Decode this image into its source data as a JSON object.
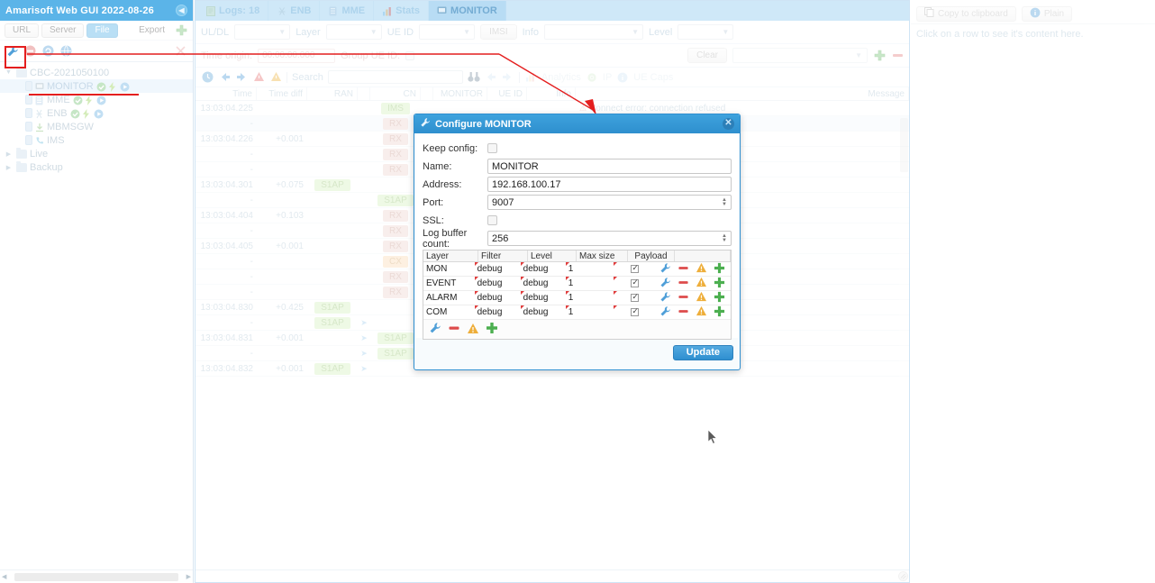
{
  "sidebar": {
    "title": "Amarisoft Web GUI 2022-08-26",
    "collapse_icon": "chevron-left-icon",
    "source_buttons": [
      {
        "label": "URL",
        "active": false
      },
      {
        "label": "Server",
        "active": false
      },
      {
        "label": "File",
        "active": true
      }
    ],
    "export_label": "Export",
    "add_icon": "plus-icon",
    "toolbar_icons": [
      "wrench-icon",
      "minus-icon",
      "refresh-icon",
      "globe-icon",
      "close-icon"
    ],
    "tree": [
      {
        "label": "CBC-2021050100",
        "type": "folder",
        "expanded": true,
        "depth": 0,
        "badges": []
      },
      {
        "label": "MONITOR",
        "type": "node",
        "depth": 1,
        "selected": true,
        "badges": [
          "check-icon",
          "bolt-icon",
          "play-icon"
        ]
      },
      {
        "label": "MME",
        "type": "node",
        "depth": 1,
        "selected": false,
        "badges": [
          "check-icon",
          "bolt-icon",
          "play-icon"
        ]
      },
      {
        "label": "ENB",
        "type": "node",
        "depth": 1,
        "selected": false,
        "badges": [
          "check-icon",
          "bolt-icon",
          "play-icon"
        ]
      },
      {
        "label": "MBMSGW",
        "type": "node",
        "depth": 1,
        "selected": false,
        "badges": []
      },
      {
        "label": "IMS",
        "type": "node",
        "depth": 1,
        "selected": false,
        "badges": []
      },
      {
        "label": "Live",
        "type": "folder",
        "expanded": false,
        "depth": 0,
        "badges": []
      },
      {
        "label": "Backup",
        "type": "folder",
        "expanded": false,
        "depth": 0,
        "badges": []
      }
    ]
  },
  "tabs": [
    {
      "label": "Logs: 18",
      "icon": "document-icon",
      "active": false
    },
    {
      "label": "ENB",
      "icon": "antenna-icon",
      "active": false
    },
    {
      "label": "MME",
      "icon": "server-icon",
      "active": false
    },
    {
      "label": "Stats",
      "icon": "chart-icon",
      "active": false
    },
    {
      "label": "MONITOR",
      "icon": "monitor-icon",
      "active": true
    }
  ],
  "filters": [
    {
      "label": "UL/DL",
      "value": ""
    },
    {
      "label": "Layer",
      "value": ""
    },
    {
      "label": "UE ID",
      "value": ""
    },
    {
      "label": "IMSI",
      "value": "",
      "button": true
    },
    {
      "label": "Info",
      "value": ""
    },
    {
      "label": "Level",
      "value": ""
    }
  ],
  "timebar": {
    "origin_label": "Time origin:",
    "origin_value": "00:00:00.000",
    "group_label": "Group UE ID:",
    "clear_label": "Clear",
    "profile_value": "",
    "add_icon": "plus-icon",
    "remove_icon": "minus-icon"
  },
  "searchbar": {
    "icons": [
      "clock-icon",
      "arrow-left-icon",
      "arrow-right-icon",
      "error-icon",
      "warning-icon"
    ],
    "search_label": "Search",
    "search_value": "",
    "search_placeholder": "",
    "binoculars_icon": "binoculars-icon",
    "nav_prev_icon": "arrow-left-icon",
    "nav_next_icon": "arrow-right-icon",
    "analytics_label": "Analytics",
    "ip_label": "IP",
    "uecaps_label": "UE Caps"
  },
  "log": {
    "columns": [
      "Time",
      "Time diff",
      "RAN",
      "",
      "CN",
      "",
      "MONITOR",
      "UE ID",
      "Info",
      "Message"
    ],
    "rows": [
      {
        "time": "13:03:04.225",
        "diff": "",
        "ran": "",
        "ran_arrow": "",
        "cn": "IMS",
        "cn_style": "green",
        "cn_arrow": "",
        "mon": "",
        "ueid": "",
        "info": "",
        "msg": "Connect error: connection refused",
        "msg_warn": true
      },
      {
        "time": "-",
        "diff": "",
        "ran": "",
        "ran_arrow": "",
        "cn": "RX",
        "cn_style": "rx",
        "cn_arrow": "",
        "mon": "",
        "ueid": "",
        "info": "",
        "msg": "",
        "alt": true
      },
      {
        "time": "13:03:04.226",
        "diff": "+0.001",
        "ran": "",
        "ran_arrow": "",
        "cn": "RX",
        "cn_style": "rx",
        "cn_arrow": "",
        "mon": "",
        "ueid": "",
        "info": "",
        "msg": ""
      },
      {
        "time": "-",
        "diff": "",
        "ran": "",
        "ran_arrow": "",
        "cn": "RX",
        "cn_style": "rx",
        "cn_arrow": "right",
        "mon": "",
        "ueid": "",
        "info": "",
        "msg": ""
      },
      {
        "time": "-",
        "diff": "",
        "ran": "",
        "ran_arrow": "",
        "cn": "RX",
        "cn_style": "rx",
        "cn_arrow": "right",
        "mon": "",
        "ueid": "",
        "info": "",
        "msg": ""
      },
      {
        "time": "13:03:04.301",
        "diff": "+0.075",
        "ran": "S1AP",
        "ran_style": "green",
        "ran_arrow": "",
        "cn": "",
        "cn_arrow": "",
        "mon": "",
        "ueid": "",
        "info": "",
        "msg": ""
      },
      {
        "time": "-",
        "diff": "",
        "ran": "",
        "ran_arrow": "",
        "cn": "S1AP",
        "cn_style": "green",
        "cn_arrow": "",
        "mon": "",
        "ueid": "",
        "info": "",
        "msg": ""
      },
      {
        "time": "13:03:04.404",
        "diff": "+0.103",
        "ran": "",
        "ran_arrow": "",
        "cn": "RX",
        "cn_style": "rx",
        "cn_arrow": "",
        "mon": "",
        "ueid": "",
        "info": "",
        "msg": ""
      },
      {
        "time": "-",
        "diff": "",
        "ran": "",
        "ran_arrow": "",
        "cn": "RX",
        "cn_style": "rx",
        "cn_arrow": "",
        "mon": "",
        "ueid": "",
        "info": "",
        "msg": ""
      },
      {
        "time": "13:03:04.405",
        "diff": "+0.001",
        "ran": "",
        "ran_arrow": "",
        "cn": "RX",
        "cn_style": "rx",
        "cn_arrow": "right",
        "mon": "",
        "ueid": "",
        "info": "",
        "msg": ""
      },
      {
        "time": "-",
        "diff": "",
        "ran": "",
        "ran_arrow": "",
        "cn": "CX",
        "cn_style": "cx",
        "cn_arrow": "right",
        "mon": "",
        "ueid": "",
        "info": "",
        "msg": ""
      },
      {
        "time": "-",
        "diff": "",
        "ran": "",
        "ran_arrow": "",
        "cn": "RX",
        "cn_style": "rx",
        "cn_arrow": "right",
        "mon": "",
        "ueid": "",
        "info": "",
        "msg": ""
      },
      {
        "time": "-",
        "diff": "",
        "ran": "",
        "ran_arrow": "",
        "cn": "RX",
        "cn_style": "rx",
        "cn_arrow": "right",
        "mon": "",
        "ueid": "",
        "info": "",
        "msg": ""
      },
      {
        "time": "13:03:04.830",
        "diff": "+0.425",
        "ran": "S1AP",
        "ran_style": "green",
        "ran_arrow": "",
        "cn": "",
        "cn_arrow": "",
        "mon": "",
        "ueid": "",
        "info": "",
        "msg": ""
      },
      {
        "time": "-",
        "diff": "",
        "ran": "S1AP",
        "ran_style": "green",
        "ran_arrow": "right",
        "cn": "",
        "cn_arrow": "",
        "mon": "",
        "ueid": "",
        "info": "",
        "msg": ""
      },
      {
        "time": "13:03:04.831",
        "diff": "+0.001",
        "ran": "",
        "ran_arrow": "right",
        "cn": "S1AP",
        "cn_style": "green",
        "cn_arrow": "",
        "mon": "",
        "ueid": "",
        "info": "",
        "msg": ""
      },
      {
        "time": "-",
        "diff": "",
        "ran": "",
        "ran_arrow": "right",
        "cn": "S1AP",
        "cn_style": "green",
        "cn_arrow": "",
        "mon": "",
        "ueid": "",
        "info": "",
        "msg": ""
      },
      {
        "time": "13:03:04.832",
        "diff": "+0.001",
        "ran": "S1AP",
        "ran_style": "green",
        "ran_arrow": "right",
        "cn": "",
        "cn_arrow": "",
        "mon": "",
        "ueid": "",
        "info": "",
        "msg": ""
      }
    ]
  },
  "right_panel": {
    "copy_label": "Copy to clipboard",
    "plain_label": "Plain",
    "copy_icon": "copy-icon",
    "info_icon": "info-icon",
    "empty_text": "Click on a row to see it's content here."
  },
  "modal": {
    "title": "Configure MONITOR",
    "title_icon": "wrench-icon",
    "close_icon": "close-icon",
    "fields": [
      {
        "label": "Keep config:",
        "type": "checkbox",
        "value": "",
        "checked": false
      },
      {
        "label": "Name:",
        "type": "text",
        "value": "MONITOR"
      },
      {
        "label": "Address:",
        "type": "text",
        "value": "192.168.100.17"
      },
      {
        "label": "Port:",
        "type": "spinner",
        "value": "9007"
      },
      {
        "label": "SSL:",
        "type": "checkbox",
        "value": "",
        "checked": false
      },
      {
        "label": "Log buffer count:",
        "type": "spinner",
        "value": "256"
      }
    ],
    "grid": {
      "columns": [
        "Layer",
        "Filter",
        "Level",
        "Max size",
        "Payload",
        ""
      ],
      "rows": [
        {
          "layer": "MON",
          "filter": "debug",
          "level": "debug",
          "max_size": "1",
          "payload": true
        },
        {
          "layer": "EVENT",
          "filter": "debug",
          "level": "debug",
          "max_size": "1",
          "payload": true
        },
        {
          "layer": "ALARM",
          "filter": "debug",
          "level": "debug",
          "max_size": "1",
          "payload": true
        },
        {
          "layer": "COM",
          "filter": "debug",
          "level": "debug",
          "max_size": "1",
          "payload": true
        }
      ],
      "row_action_icons": [
        "wrench-icon",
        "minus-icon",
        "warning-icon",
        "plus-icon"
      ],
      "toolbar_icons": [
        "wrench-icon",
        "minus-icon",
        "warning-icon",
        "plus-icon"
      ]
    },
    "update_label": "Update"
  },
  "colors": {
    "accent": "#2f8fd0",
    "header": "#5bb4e8",
    "annotation": "#e41e1e",
    "tab_bar": "#cfe8f8",
    "green_pill": "#d9f2c2",
    "rx_pill": "#f0d9d4",
    "cx_pill": "#fbddb8"
  }
}
